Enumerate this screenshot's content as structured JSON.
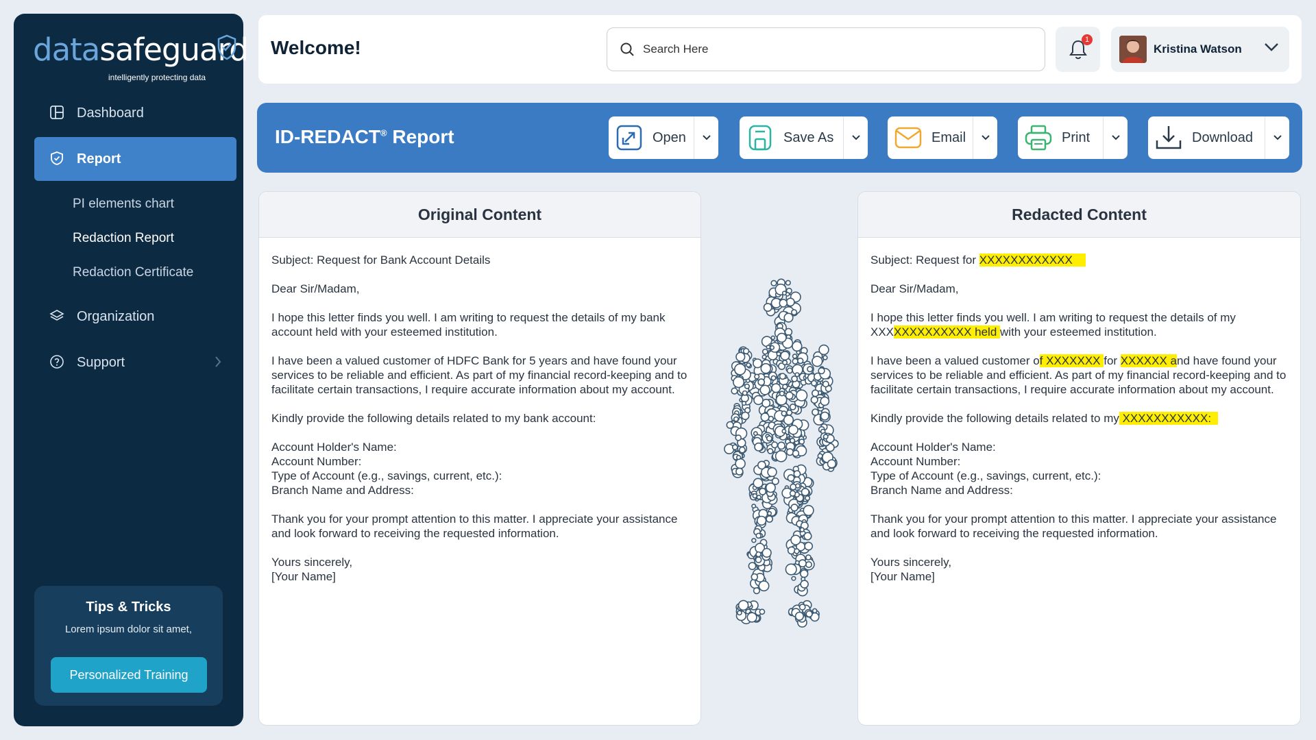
{
  "brand": {
    "name_part1": "data",
    "name_part2": "safeguard",
    "tagline": "intelligently  protecting data"
  },
  "sidebar": {
    "items": [
      {
        "label": "Dashboard",
        "icon": "dashboard-icon"
      },
      {
        "label": "Report",
        "icon": "shield-check-icon",
        "active": true
      },
      {
        "label": "Organization",
        "icon": "layers-icon"
      },
      {
        "label": "Support",
        "icon": "help-circle-icon"
      }
    ],
    "subitems": [
      "PI elements chart",
      "Redaction Report",
      "Redaction Certificate"
    ],
    "tips": {
      "title": "Tips & Tricks",
      "text": "Lorem ipsum dolor sit amet,",
      "button": "Personalized Training"
    }
  },
  "header": {
    "welcome": "Welcome!",
    "search_placeholder": "Search Here",
    "notification_count": "1",
    "user_name": "Kristina Watson"
  },
  "report": {
    "title": "ID-REDACT",
    "title_mark": "®",
    "title_suffix": " Report",
    "actions": [
      {
        "label": "Open",
        "icon": "open-external-icon",
        "color": "#2b6cb0"
      },
      {
        "label": "Save As",
        "icon": "save-icon",
        "color": "#2bb3a3"
      },
      {
        "label": "Email",
        "icon": "envelope-icon",
        "color": "#f0a830"
      },
      {
        "label": "Print",
        "icon": "printer-icon",
        "color": "#3cb371"
      },
      {
        "label": "Download",
        "icon": "download-icon",
        "color": "#2a3a4a"
      }
    ]
  },
  "original": {
    "heading": "Original Content",
    "subject": "Subject: Request for Bank Account Details",
    "greeting": "Dear Sir/Madam,",
    "p1": "I hope this letter finds you well. I am writing to request the details of my bank account held with your esteemed institution.",
    "p2": "I have been a valued customer of HDFC Bank for 5 years and have found your services to be reliable and efficient. As part of my financial record-keeping and to facilitate certain transactions, I require accurate information about my account.",
    "p3": "Kindly provide the following details related to my bank account:",
    "list": [
      "Account Holder's Name:",
      "Account Number:",
      "Type of Account (e.g., savings, current, etc.):",
      "Branch Name and Address:"
    ],
    "p4": "Thank you for your prompt attention to this matter. I appreciate your assistance and look forward to receiving the requested information.",
    "closing": "Yours sincerely,",
    "signature": "[Your Name]"
  },
  "redacted": {
    "heading": "Redacted Content",
    "subject_pre": "Subject: Request for ",
    "subject_red": "XXXXXXXXXXXX    ",
    "greeting": "Dear Sir/Madam,",
    "p1_pre": "I hope this letter finds you well. I am writing to request the details of my XXX",
    "p1_red": "XXXXXXXXXX held ",
    "p1_post": "with your esteemed institution.",
    "p2_a": "I have been a valued customer o",
    "p2_red1": "f XXXXXXX ",
    "p2_b": "for ",
    "p2_red2": "XXXXXX a",
    "p2_c": "nd have found your services to be reliable and efficient. As part of my financial record-keeping and to facilitate certain transactions, I require accurate information about my account.",
    "p3_pre": "Kindly provide the following details related to my",
    "p3_red": " XXXXXXXXXXX:  ",
    "list": [
      "Account Holder's Name:",
      "Account Number:",
      "Type of Account (e.g., savings, current, etc.):",
      "Branch Name and Address:"
    ],
    "p4": "Thank you for your prompt attention to this matter. I appreciate your assistance and look forward to receiving the requested information.",
    "closing": "Yours sincerely,",
    "signature": "[Your Name]"
  },
  "colors": {
    "sidebar_bg": "#0d2a43",
    "accent": "#3b7bc4",
    "highlight": "#ffee00"
  }
}
